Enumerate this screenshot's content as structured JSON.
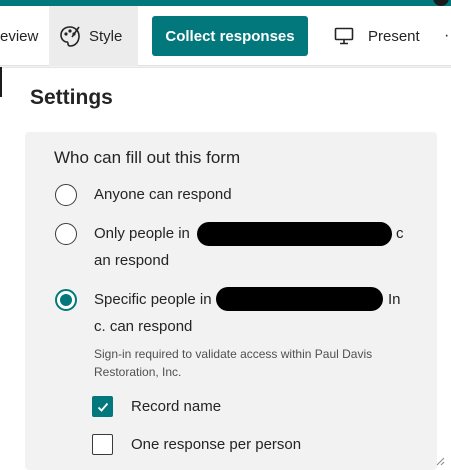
{
  "toolbar": {
    "preview_label": "eview",
    "style_label": "Style",
    "collect_label": "Collect responses",
    "present_label": "Present",
    "more_label": "·"
  },
  "settings": {
    "title": "Settings",
    "section_title": "Who can fill out this form",
    "options": [
      {
        "line1_prefix": "Anyone can respond",
        "selected": false
      },
      {
        "line1_prefix": "Only people in",
        "line1_suffix": "c",
        "line2": "an respond",
        "selected": false
      },
      {
        "line1_prefix": "Specific people in",
        "line1_suffix": "In",
        "line2": "c. can respond",
        "selected": true
      }
    ],
    "hint": "Sign-in required to validate access within Paul Davis Restoration, Inc.",
    "checkboxes": [
      {
        "label": "Record name",
        "checked": true
      },
      {
        "label": "One response per person",
        "checked": false
      }
    ]
  },
  "colors": {
    "accent": "#03787c",
    "background": "#f3f3f3",
    "card": "#f2f2f2"
  },
  "icons": [
    "style-palette-icon",
    "present-monitor-icon",
    "check-icon"
  ]
}
